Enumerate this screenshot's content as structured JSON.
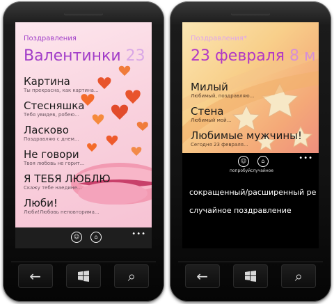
{
  "left": {
    "app_title": "Поздравления",
    "pivot_current": "Валентинки",
    "pivot_next": "23",
    "items": [
      {
        "title": "Картина",
        "subtitle": "Ты прекрасна, как картина..."
      },
      {
        "title": "Стесняшка",
        "subtitle": "Тебя увидев, робею..."
      },
      {
        "title": "Ласково",
        "subtitle": "Поздравляю с днем..."
      },
      {
        "title": "Не говори",
        "subtitle": "Твоя любовь не горит..."
      },
      {
        "title": "Я ТЕБЯ ЛЮБЛЮ",
        "subtitle": "Скажу тебе наедине..."
      },
      {
        "title": "Люби!",
        "subtitle": "Люби!Любовь неповторима..."
      }
    ],
    "more": "•••"
  },
  "right": {
    "app_title": "Поздравления*",
    "pivot_current": "23 февраля",
    "pivot_next": "8 м",
    "items": [
      {
        "title": "Милый",
        "subtitle": "Любимый, поздравляю..."
      },
      {
        "title": "Стена",
        "subtitle": "Любимый мой..."
      },
      {
        "title": "Любимые мужчины!",
        "subtitle": "Сегодня 23 февраля..."
      }
    ],
    "appbar": {
      "try_label": "попробуй",
      "random_label": "случайное",
      "more": "•••"
    },
    "menu_items": [
      "сокращенный/расширенный ре",
      "случайное поздравление"
    ]
  },
  "hardware_keys": {
    "back": "←",
    "search": "⌕"
  }
}
